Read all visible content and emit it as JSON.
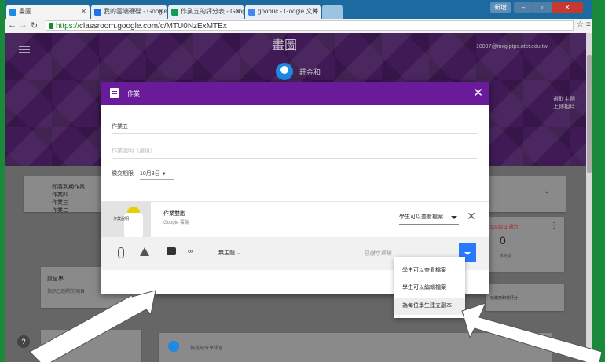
{
  "browser": {
    "tabs": [
      {
        "label": "畫圖"
      },
      {
        "label": "我的雲端硬碟 - Google 雲"
      },
      {
        "label": "作業五的評分表 - Google"
      },
      {
        "label": "goobric - Google 文件"
      }
    ],
    "controls": {
      "user_btn": "新增"
    },
    "url": {
      "https": "https://",
      "rest": "classroom.google.com/c/MTU0NzExMTEx"
    }
  },
  "classroom": {
    "class_name": "畫圖",
    "teacher": "莊金和",
    "account": "10097@mxg.ptps.ntct.edu.tw",
    "theme_btn": "選取主題",
    "upload_btn": "上傳相片"
  },
  "background": {
    "upcoming": [
      "即將到期作業",
      "作業四",
      "作業三",
      "作業二"
    ],
    "about_title": "訊息串",
    "about_text": "指示已刪除的項目",
    "date_label": "10月3日 週六",
    "count": "0",
    "count_sub": "未完成",
    "right_link": "已繳交和待評分",
    "post_placeholder": "與班級分享訊息..."
  },
  "dialog": {
    "title": "作業",
    "assignment_title": "作業五",
    "description_placeholder": "作業說明（選填）",
    "due_label": "繳交期限",
    "due_value": "10月3日",
    "attachment": {
      "thumb_label": "作業說明",
      "title": "作業雙胞",
      "source": "Google 雲端"
    },
    "permission": "學生可以查看檔案",
    "topic": "無主題",
    "saved_text": "已儲存草稿"
  },
  "permission_menu": [
    "學生可以查看檔案",
    "學生可以編輯檔案",
    "為每位學生建立副本"
  ],
  "help": "?"
}
